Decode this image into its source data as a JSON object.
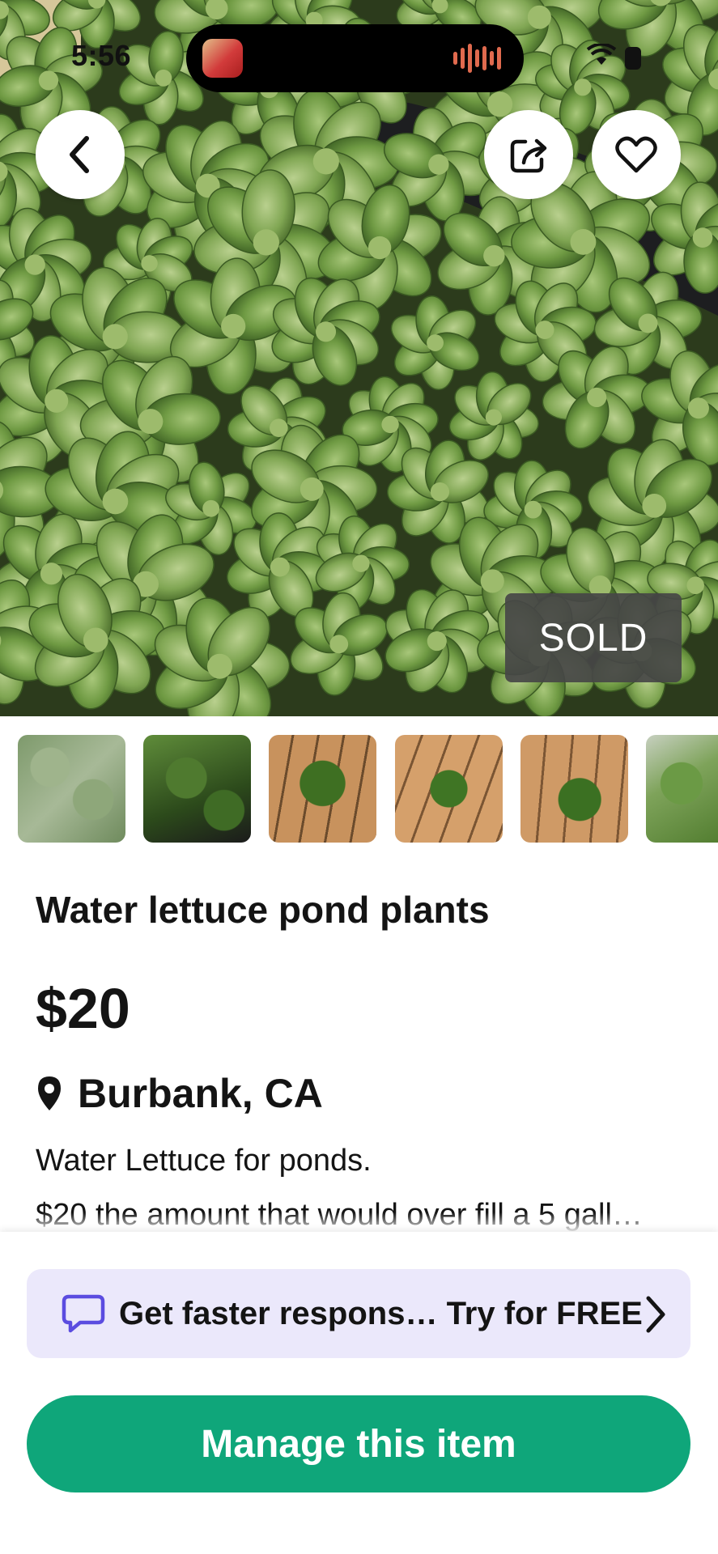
{
  "status_bar": {
    "time": "5:56"
  },
  "hero": {
    "badge": "SOLD",
    "buttons": {
      "back_icon": "chevron-left-icon",
      "share_icon": "share-icon",
      "favorite_icon": "heart-icon"
    }
  },
  "listing": {
    "title": "Water lettuce pond plants",
    "price": "$20",
    "location": "Burbank, CA",
    "description_lines": [
      "Water Lettuce for ponds.",
      "$20 the amount that would over fill a 5 gall…"
    ]
  },
  "promo": {
    "text": "Get faster respons… Try for FREE",
    "icon": "chat-bubble-icon"
  },
  "actions": {
    "manage_label": "Manage this item"
  },
  "colors": {
    "accent_green": "#0fa67a",
    "promo_bg": "#ebe8fb",
    "promo_icon": "#5b4ce0",
    "sold_badge": "#464646"
  }
}
